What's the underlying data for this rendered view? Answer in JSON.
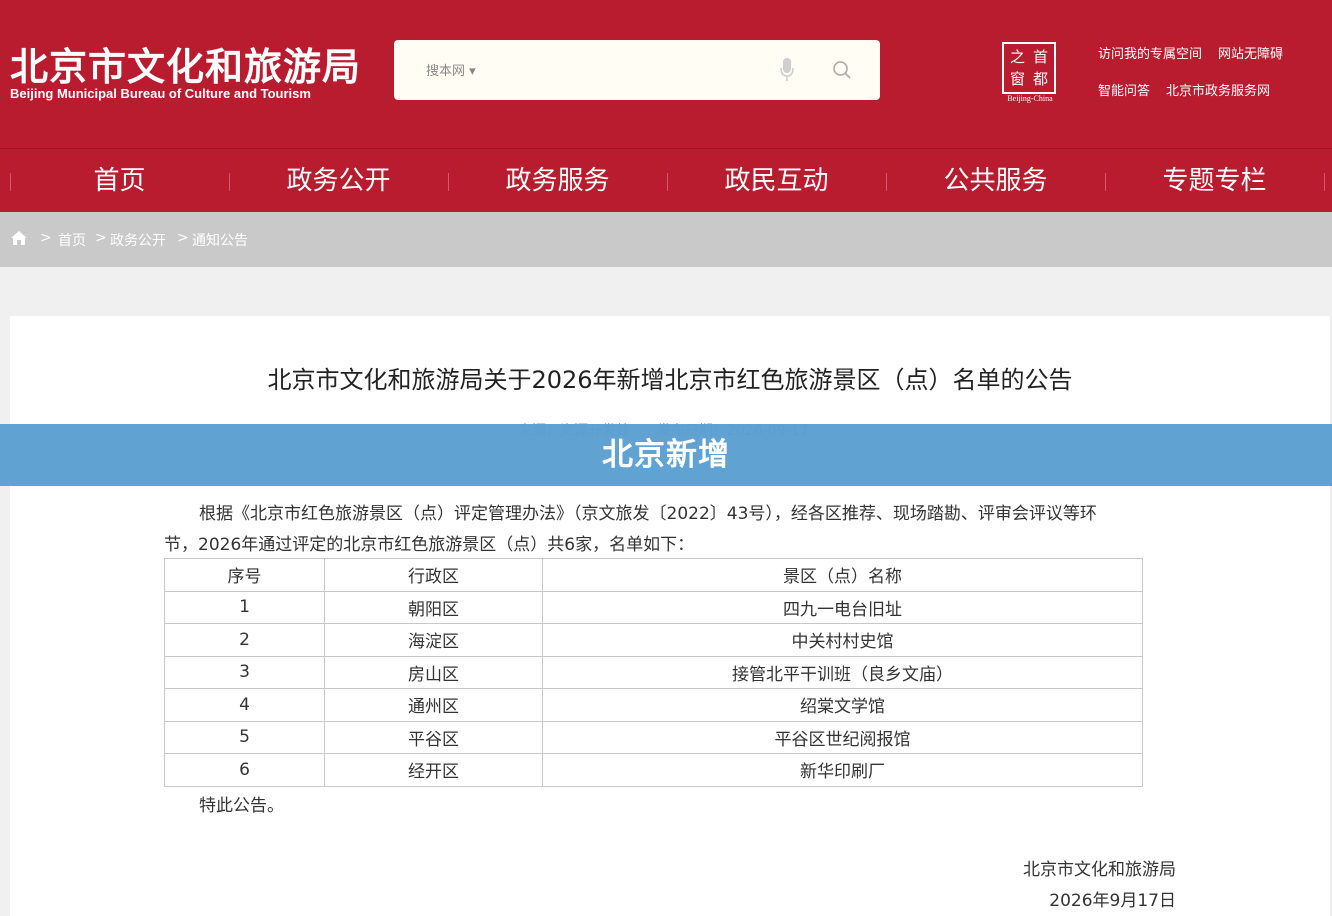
{
  "header": {
    "logo_cn": "北京市文化和旅游局",
    "logo_en": "Beijing Municipal Bureau of Culture and Tourism",
    "search_scope": "搜本网 ▾",
    "badge_chars": [
      "之",
      "首",
      "窗",
      "都"
    ],
    "badge_caption": "Beijing-China",
    "links": {
      "my_space": "访问我的专属空间",
      "accessibility": "网站无障碍",
      "qa": "智能问答",
      "gov_service": "北京市政务服务网"
    }
  },
  "nav": [
    "首页",
    "政务公开",
    "政务服务",
    "政民互动",
    "公共服务",
    "专题专栏"
  ],
  "breadcrumb": {
    "items": [
      "首页",
      "政务公开",
      "通知公告"
    ],
    "separator": ">"
  },
  "article": {
    "title": "北京市文化和旅游局关于2026年新增北京市红色旅游景区（点）名单的公告",
    "source": "来源：资源开发处",
    "date": "发布日期：2026-09-17",
    "para_line1": "根据《北京市红色旅游景区（点）评定管理办法》（京文旅发〔2022〕43号），经各区推荐、现场踏勘、评审会评议等环",
    "para_line2": "节，2026年通过评定的北京市红色旅游景区（点）共6家，名单如下：",
    "table": {
      "headers": [
        "序号",
        "行政区",
        "景区（点）名称"
      ],
      "rows": [
        [
          "1",
          "朝阳区",
          "四九一电台旧址"
        ],
        [
          "2",
          "海淀区",
          "中关村村史馆"
        ],
        [
          "3",
          "房山区",
          "接管北平干训班（良乡文庙）"
        ],
        [
          "4",
          "通州区",
          "绍棠文学馆"
        ],
        [
          "5",
          "平谷区",
          "平谷区世纪阅报馆"
        ],
        [
          "6",
          "经开区",
          "新华印刷厂"
        ]
      ]
    },
    "closing": "特此公告。",
    "signer": "北京市文化和旅游局",
    "sign_date": "2026年9月17日"
  },
  "banner": {
    "text": "北京新增"
  },
  "colors": {
    "brand_red": "#b81c2e",
    "banner_blue": "#5a9fd0",
    "breadcrumb_bg": "#c9c9c9"
  },
  "icons": [
    "mic-icon",
    "search-icon",
    "home-icon"
  ]
}
